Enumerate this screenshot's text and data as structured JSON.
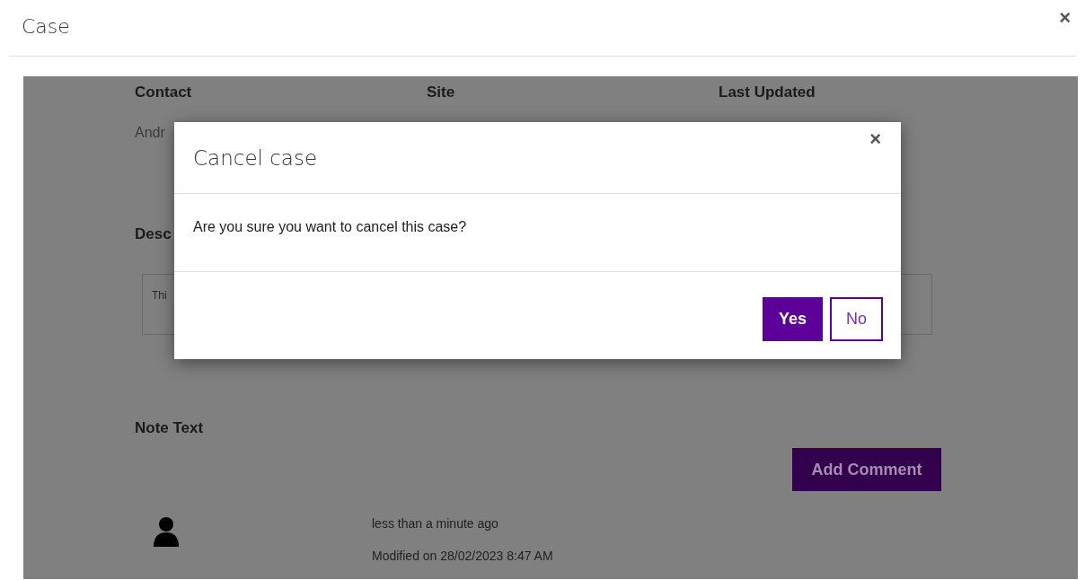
{
  "window": {
    "title": "Case",
    "close": "×"
  },
  "details": {
    "columns": [
      {
        "label": "Contact",
        "value": "Andr"
      },
      {
        "label": "Site"
      },
      {
        "label": "Last Updated"
      }
    ],
    "description_label": "Desc",
    "description_text": "Thi"
  },
  "notes": {
    "label": "Note Text",
    "add_button": "Add Comment",
    "comments": [
      {
        "time": "less than a minute ago",
        "modified": "Modified on 28/02/2023 8:47 AM"
      }
    ]
  },
  "dialog": {
    "title": "Cancel case",
    "close": "×",
    "message": "Are you sure you want to cancel this case?",
    "buttons": [
      {
        "label": "Yes",
        "kind": "primary"
      },
      {
        "label": "No",
        "kind": "secondary"
      }
    ]
  }
}
